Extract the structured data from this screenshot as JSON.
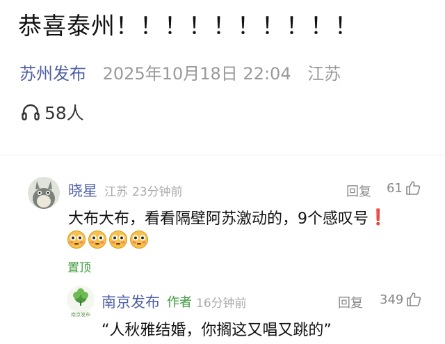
{
  "post": {
    "title": "恭喜泰州！！！！！！！！！！",
    "account": "苏州发布",
    "timestamp": "2025年10月18日 22:04",
    "location": "江苏",
    "listens": "58人"
  },
  "comments": [
    {
      "name": "晓星",
      "location": "江苏",
      "time": "23分钟前",
      "reply_label": "回复",
      "likes": "61",
      "text": "大布大布，看看隔壁阿苏激动的，9个感叹号",
      "text_emoji": "❗",
      "emoji_count": "4",
      "pin_label": "置顶",
      "avatar_icon": "totoro-avatar"
    },
    {
      "name": "南京发布",
      "author_badge": "作者",
      "time": "16分钟前",
      "reply_label": "回复",
      "likes": "349",
      "text": "“人秋雅结婚，你搁这又唱又跳的”",
      "avatar_icon": "nanjing-fabu-logo",
      "avatar_caption": "南京发布"
    }
  ],
  "colors": {
    "account_blue": "#4d5fa3",
    "author_green": "#3c9a3c",
    "gray_text": "#999999",
    "exclaim_red": "#e0312b"
  }
}
